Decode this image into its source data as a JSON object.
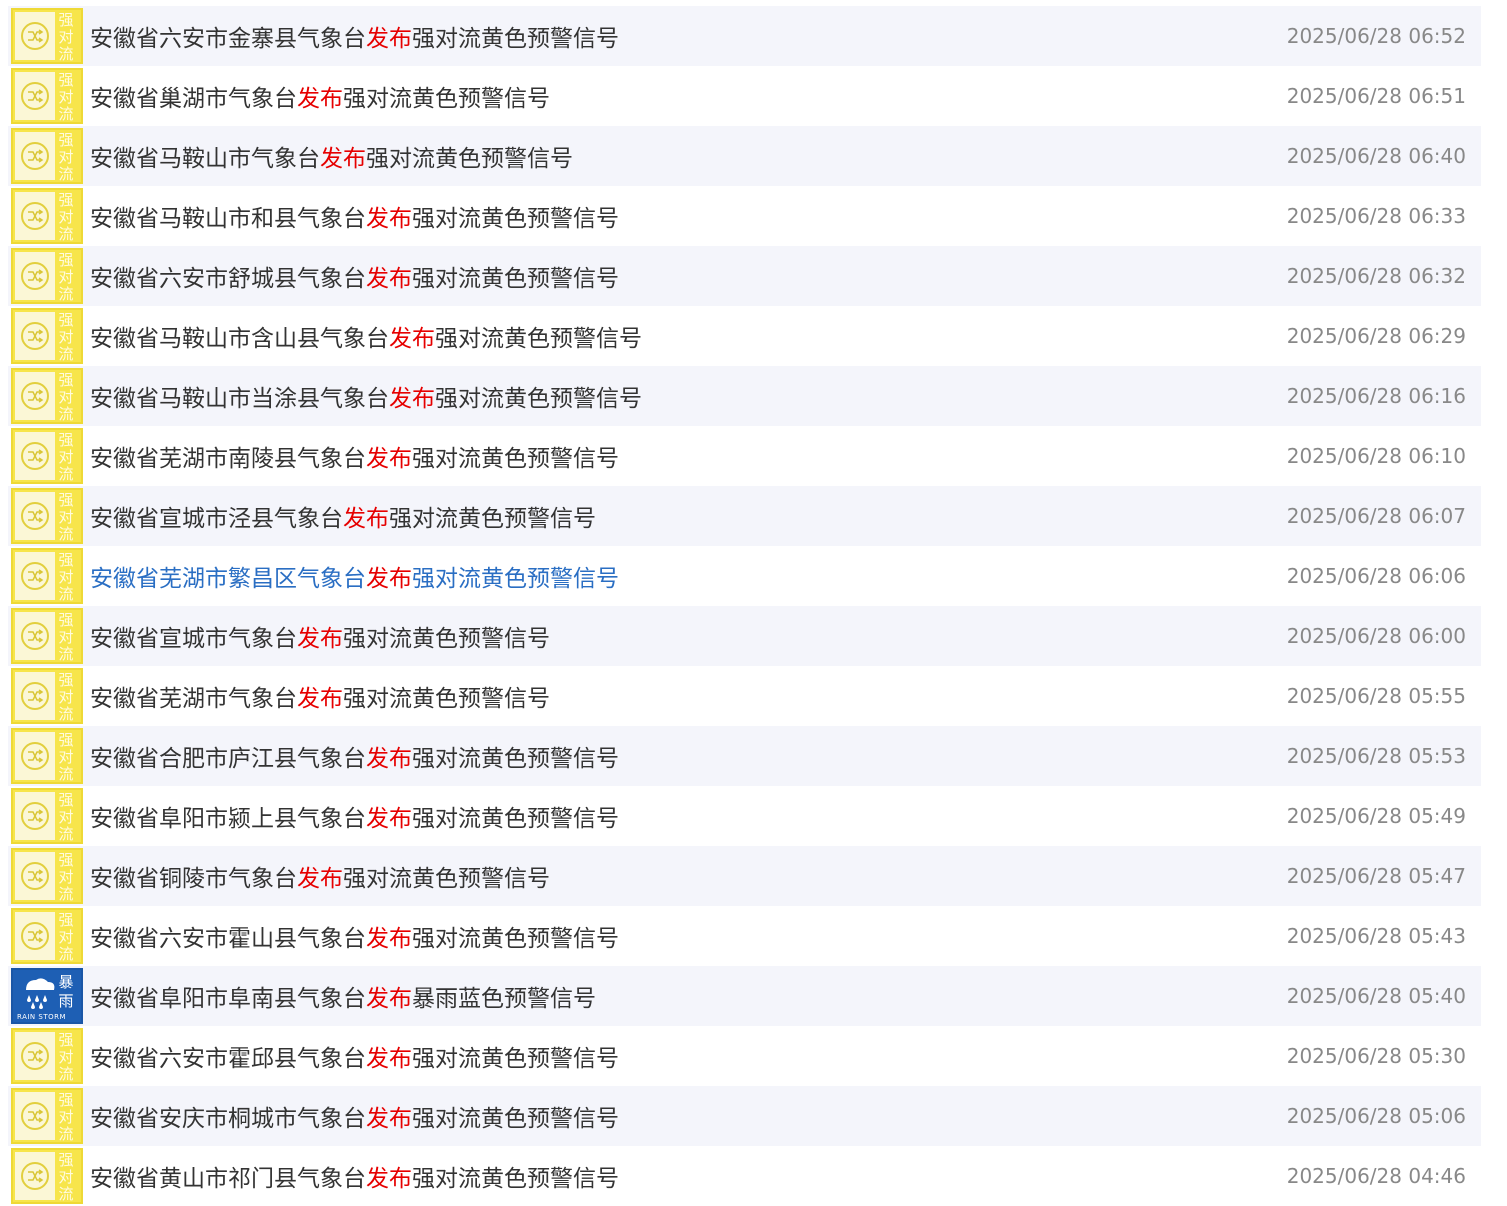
{
  "colors": {
    "strong_convection_yellow": "#f7e54b",
    "rainstorm_blue": "#1e5fb4",
    "publish_red": "#e60000",
    "link_blue": "#2a6ec3",
    "time_gray": "#888888"
  },
  "alerts": [
    {
      "icon": "strong-convection-yellow-icon",
      "icon_label": [
        "强",
        "对",
        "流"
      ],
      "title_pre": "安徽省六安市金寨县气象台",
      "title_mid": "发布",
      "title_post": "强对流黄色预警信号",
      "time": "2025/06/28 06:52"
    },
    {
      "icon": "strong-convection-yellow-icon",
      "icon_label": [
        "强",
        "对",
        "流"
      ],
      "title_pre": "安徽省巢湖市气象台",
      "title_mid": "发布",
      "title_post": "强对流黄色预警信号",
      "time": "2025/06/28 06:51"
    },
    {
      "icon": "strong-convection-yellow-icon",
      "icon_label": [
        "强",
        "对",
        "流"
      ],
      "title_pre": "安徽省马鞍山市气象台",
      "title_mid": "发布",
      "title_post": "强对流黄色预警信号",
      "time": "2025/06/28 06:40"
    },
    {
      "icon": "strong-convection-yellow-icon",
      "icon_label": [
        "强",
        "对",
        "流"
      ],
      "title_pre": "安徽省马鞍山市和县气象台",
      "title_mid": "发布",
      "title_post": "强对流黄色预警信号",
      "time": "2025/06/28 06:33"
    },
    {
      "icon": "strong-convection-yellow-icon",
      "icon_label": [
        "强",
        "对",
        "流"
      ],
      "title_pre": "安徽省六安市舒城县气象台",
      "title_mid": "发布",
      "title_post": "强对流黄色预警信号",
      "time": "2025/06/28 06:32"
    },
    {
      "icon": "strong-convection-yellow-icon",
      "icon_label": [
        "强",
        "对",
        "流"
      ],
      "title_pre": "安徽省马鞍山市含山县气象台",
      "title_mid": "发布",
      "title_post": "强对流黄色预警信号",
      "time": "2025/06/28 06:29"
    },
    {
      "icon": "strong-convection-yellow-icon",
      "icon_label": [
        "强",
        "对",
        "流"
      ],
      "title_pre": "安徽省马鞍山市当涂县气象台",
      "title_mid": "发布",
      "title_post": "强对流黄色预警信号",
      "time": "2025/06/28 06:16"
    },
    {
      "icon": "strong-convection-yellow-icon",
      "icon_label": [
        "强",
        "对",
        "流"
      ],
      "title_pre": "安徽省芜湖市南陵县气象台",
      "title_mid": "发布",
      "title_post": "强对流黄色预警信号",
      "time": "2025/06/28 06:10"
    },
    {
      "icon": "strong-convection-yellow-icon",
      "icon_label": [
        "强",
        "对",
        "流"
      ],
      "title_pre": "安徽省宣城市泾县气象台",
      "title_mid": "发布",
      "title_post": "强对流黄色预警信号",
      "time": "2025/06/28 06:07"
    },
    {
      "icon": "strong-convection-yellow-icon",
      "icon_label": [
        "强",
        "对",
        "流"
      ],
      "title_pre": "安徽省芜湖市繁昌区气象台",
      "title_mid": "发布",
      "title_post": "强对流黄色预警信号",
      "time": "2025/06/28 06:06",
      "hovered": true
    },
    {
      "icon": "strong-convection-yellow-icon",
      "icon_label": [
        "强",
        "对",
        "流"
      ],
      "title_pre": "安徽省宣城市气象台",
      "title_mid": "发布",
      "title_post": "强对流黄色预警信号",
      "time": "2025/06/28 06:00"
    },
    {
      "icon": "strong-convection-yellow-icon",
      "icon_label": [
        "强",
        "对",
        "流"
      ],
      "title_pre": "安徽省芜湖市气象台",
      "title_mid": "发布",
      "title_post": "强对流黄色预警信号",
      "time": "2025/06/28 05:55"
    },
    {
      "icon": "strong-convection-yellow-icon",
      "icon_label": [
        "强",
        "对",
        "流"
      ],
      "title_pre": "安徽省合肥市庐江县气象台",
      "title_mid": "发布",
      "title_post": "强对流黄色预警信号",
      "time": "2025/06/28 05:53"
    },
    {
      "icon": "strong-convection-yellow-icon",
      "icon_label": [
        "强",
        "对",
        "流"
      ],
      "title_pre": "安徽省阜阳市颍上县气象台",
      "title_mid": "发布",
      "title_post": "强对流黄色预警信号",
      "time": "2025/06/28 05:49"
    },
    {
      "icon": "strong-convection-yellow-icon",
      "icon_label": [
        "强",
        "对",
        "流"
      ],
      "title_pre": "安徽省铜陵市气象台",
      "title_mid": "发布",
      "title_post": "强对流黄色预警信号",
      "time": "2025/06/28 05:47"
    },
    {
      "icon": "strong-convection-yellow-icon",
      "icon_label": [
        "强",
        "对",
        "流"
      ],
      "title_pre": "安徽省六安市霍山县气象台",
      "title_mid": "发布",
      "title_post": "强对流黄色预警信号",
      "time": "2025/06/28 05:43"
    },
    {
      "icon": "rainstorm-blue-icon",
      "icon_label": [
        "暴",
        "雨"
      ],
      "icon_caption": "RAIN STORM",
      "title_pre": "安徽省阜阳市阜南县气象台",
      "title_mid": "发布",
      "title_post": "暴雨蓝色预警信号",
      "time": "2025/06/28 05:40"
    },
    {
      "icon": "strong-convection-yellow-icon",
      "icon_label": [
        "强",
        "对",
        "流"
      ],
      "title_pre": "安徽省六安市霍邱县气象台",
      "title_mid": "发布",
      "title_post": "强对流黄色预警信号",
      "time": "2025/06/28 05:30"
    },
    {
      "icon": "strong-convection-yellow-icon",
      "icon_label": [
        "强",
        "对",
        "流"
      ],
      "title_pre": "安徽省安庆市桐城市气象台",
      "title_mid": "发布",
      "title_post": "强对流黄色预警信号",
      "time": "2025/06/28 05:06"
    },
    {
      "icon": "strong-convection-yellow-icon",
      "icon_label": [
        "强",
        "对",
        "流"
      ],
      "title_pre": "安徽省黄山市祁门县气象台",
      "title_mid": "发布",
      "title_post": "强对流黄色预警信号",
      "time": "2025/06/28 04:46"
    }
  ]
}
